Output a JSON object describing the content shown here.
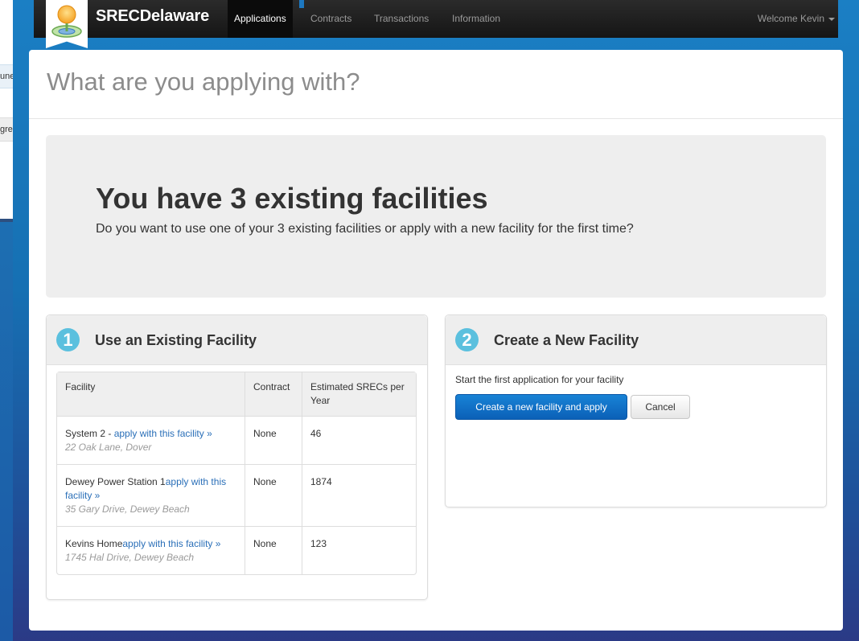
{
  "navbar": {
    "brand": "SRECDelaware",
    "items": [
      {
        "label": "Applications",
        "active": true
      },
      {
        "label": "Contracts",
        "active": false
      },
      {
        "label": "Transactions",
        "active": false
      },
      {
        "label": "Information",
        "active": false
      }
    ],
    "welcome": "Welcome Kevin"
  },
  "background_fragments": {
    "frag1": "une",
    "frag2": "gre"
  },
  "page": {
    "title": "What are you applying with?"
  },
  "hero": {
    "heading": "You have 3 existing facilities",
    "subheading": "Do you want to use one of your 3 existing facilities or apply with a new facility for the first time?"
  },
  "existing": {
    "step": "1",
    "title": "Use an Existing Facility",
    "columns": [
      "Facility",
      "Contract",
      "Estimated SRECs per Year"
    ],
    "rows": [
      {
        "name": "System 2 - ",
        "link": "apply with this facility »",
        "address": "22 Oak Lane, Dover",
        "contract": "None",
        "srecs": "46"
      },
      {
        "name": "Dewey Power Station 1",
        "link": "apply with this facility »",
        "address": "35 Gary Drive, Dewey Beach",
        "contract": "None",
        "srecs": "1874"
      },
      {
        "name": "Kevins Home",
        "link": "apply with this facility »",
        "address": "1745 Hal Drive, Dewey Beach",
        "contract": "None",
        "srecs": "123"
      }
    ]
  },
  "new_facility": {
    "step": "2",
    "title": "Create a New Facility",
    "description": "Start the first application for your facility",
    "primary_button": "Create a new facility and apply",
    "cancel_button": "Cancel"
  },
  "colors": {
    "accent_blue": "#0b60b7",
    "step_circle": "#5bc0de",
    "navbar": "#1b1b1b",
    "link": "#2a6fb8"
  }
}
